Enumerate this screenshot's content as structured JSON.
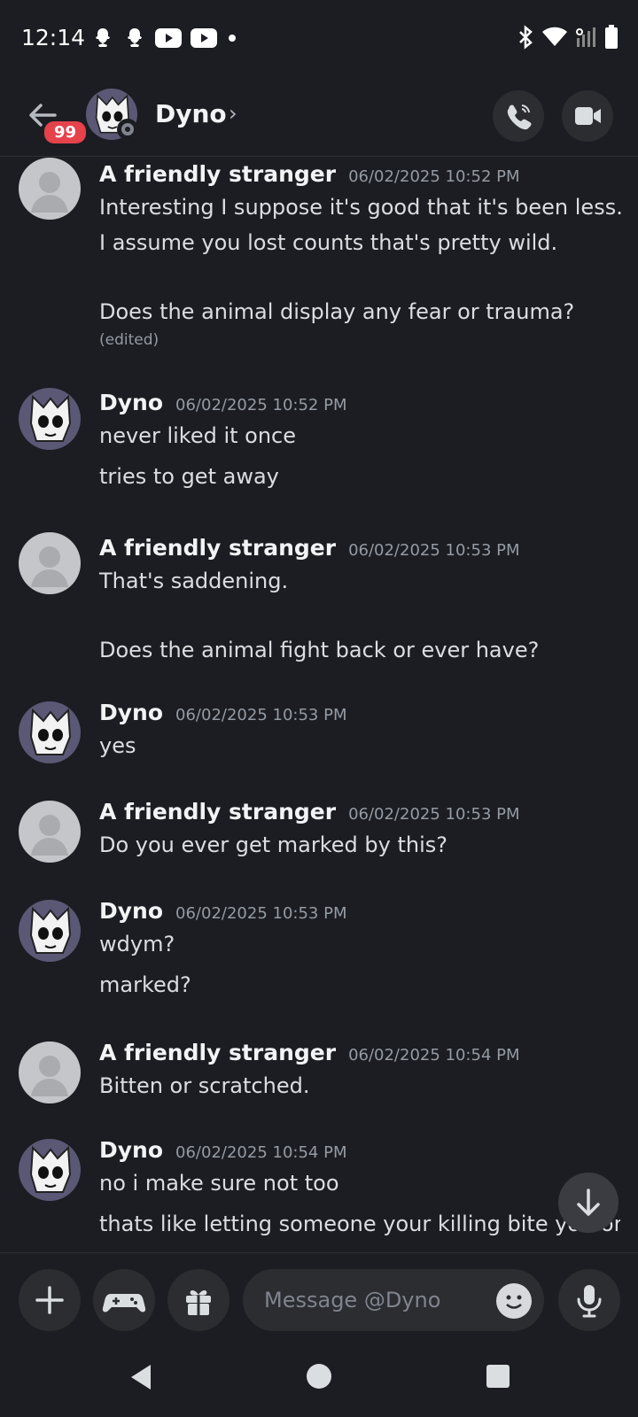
{
  "status_bar": {
    "time": "12:14",
    "left_icons": [
      "snapchat-icon",
      "snapchat-icon",
      "youtube-icon",
      "youtube-icon",
      "dot-icon"
    ],
    "right_icons": [
      "bluetooth-icon",
      "wifi-icon",
      "signal-icon",
      "battery-icon"
    ]
  },
  "header": {
    "unread_badge": "99",
    "channel_name": "Dyno",
    "chevron": "›",
    "call_icon": "phone-icon",
    "video_icon": "video-camera-icon"
  },
  "messages": [
    {
      "author": "A friendly stranger",
      "avatar": "default-avatar",
      "timestamp": "06/02/2025 10:52 PM",
      "lines": [
        "Interesting I suppose it's good that it's been less.",
        "I assume you lost counts that's pretty wild.",
        "",
        "Does the animal display any fear or trauma?"
      ],
      "edited": "(edited)"
    },
    {
      "author": "Dyno",
      "avatar": "dyno-avatar",
      "timestamp": "06/02/2025 10:52 PM",
      "lines": [
        "never liked it once",
        "tries to get away"
      ]
    },
    {
      "author": "A friendly stranger",
      "avatar": "default-avatar",
      "timestamp": "06/02/2025 10:53 PM",
      "lines": [
        "That's saddening.",
        "",
        "Does the animal fight back or ever have?"
      ]
    },
    {
      "author": "Dyno",
      "avatar": "dyno-avatar",
      "timestamp": "06/02/2025 10:53 PM",
      "lines": [
        "yes"
      ]
    },
    {
      "author": "A friendly stranger",
      "avatar": "default-avatar",
      "timestamp": "06/02/2025 10:53 PM",
      "lines": [
        "Do you ever get marked by this?"
      ]
    },
    {
      "author": "Dyno",
      "avatar": "dyno-avatar",
      "timestamp": "06/02/2025 10:53 PM",
      "lines": [
        "wdym?",
        "marked?"
      ]
    },
    {
      "author": "A friendly stranger",
      "avatar": "default-avatar",
      "timestamp": "06/02/2025 10:54 PM",
      "lines": [
        "Bitten or scratched."
      ]
    },
    {
      "author": "Dyno",
      "avatar": "dyno-avatar",
      "timestamp": "06/02/2025 10:54 PM",
      "lines": [
        "no i make sure not too",
        "thats like letting someone your killing bite you or"
      ]
    }
  ],
  "composer": {
    "add_icon": "plus-icon",
    "games_icon": "gamepad-icon",
    "gift_icon": "gift-icon",
    "placeholder": "Message @Dyno",
    "emoji_icon": "emoji-icon",
    "mic_icon": "microphone-icon"
  },
  "jump_to_present_icon": "arrow-down-icon",
  "nav_bar": {
    "back_icon": "nav-back-icon",
    "home_icon": "nav-home-icon",
    "recents_icon": "nav-recents-icon"
  },
  "colors": {
    "background": "#1c1d22",
    "badge": "#e5424c",
    "text": "#dbdee1",
    "timestamp": "#949ba4",
    "button_bg": "#2b2d31"
  }
}
